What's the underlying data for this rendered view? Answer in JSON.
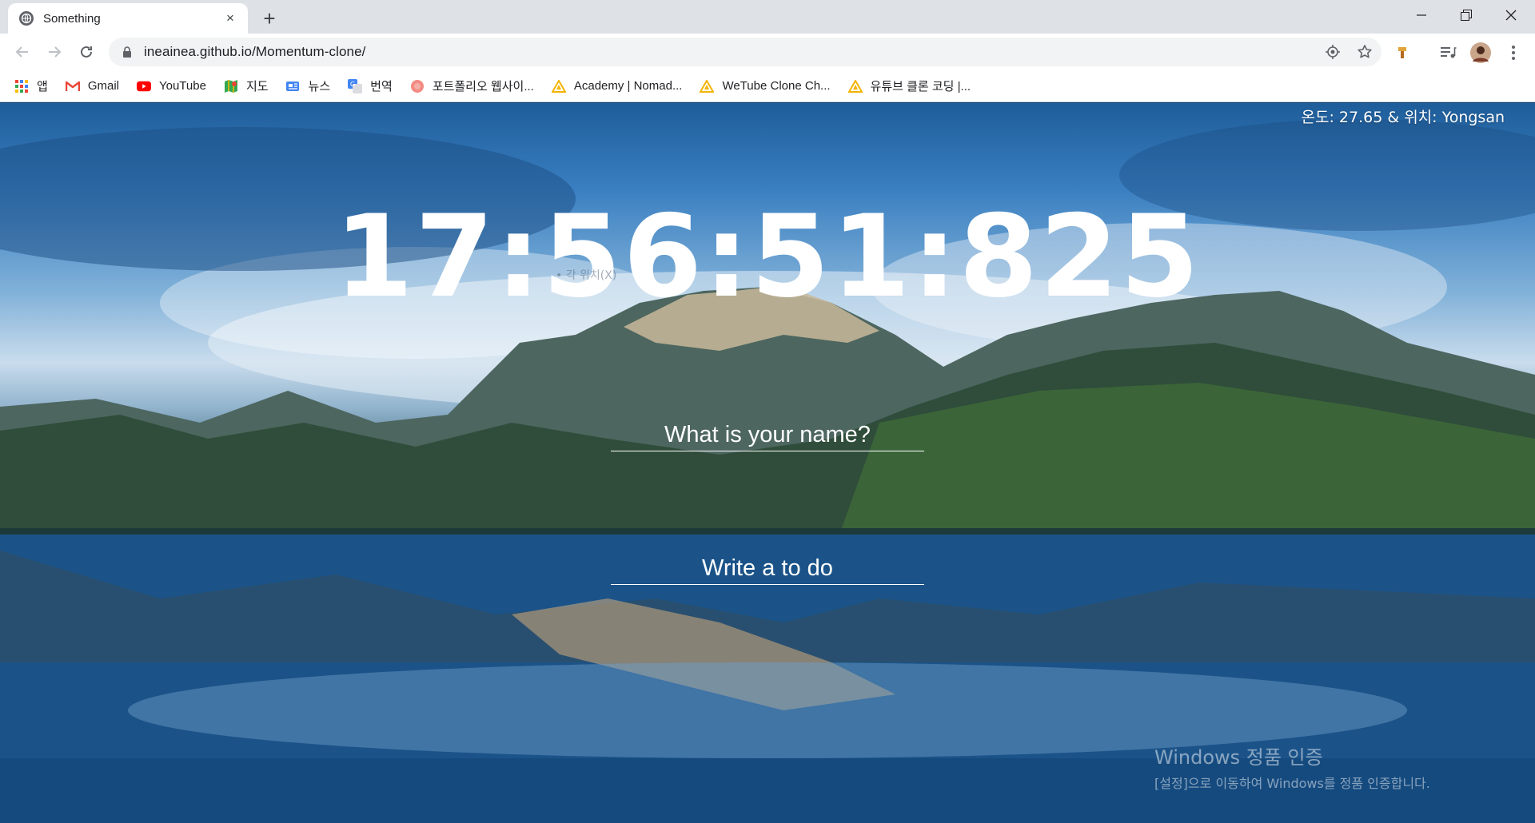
{
  "tab": {
    "title": "Something",
    "close_glyph": "×",
    "new_tab_glyph": "+",
    "favicon": "globe-icon"
  },
  "window_controls": {
    "minimize": "─",
    "maximize": "❐",
    "close": "✕"
  },
  "toolbar": {
    "url": "ineainea.github.io/Momentum-clone/",
    "icons": [
      "back-icon",
      "forward-icon",
      "reload-icon",
      "lock-icon",
      "location-icon",
      "star-icon",
      "extension-icon",
      "media-icon",
      "avatar",
      "menu-icon"
    ]
  },
  "bookmarks": [
    {
      "label": "앱",
      "icon": "apps-grid-icon"
    },
    {
      "label": "Gmail",
      "icon": "gmail-icon"
    },
    {
      "label": "YouTube",
      "icon": "youtube-icon"
    },
    {
      "label": "지도",
      "icon": "maps-icon"
    },
    {
      "label": "뉴스",
      "icon": "news-icon"
    },
    {
      "label": "번역",
      "icon": "translate-icon"
    },
    {
      "label": "포트폴리오 웹사이...",
      "icon": "portfolio-icon"
    },
    {
      "label": "Academy | Nomad...",
      "icon": "nomad-icon"
    },
    {
      "label": "WeTube Clone Ch...",
      "icon": "nomad-icon"
    },
    {
      "label": "유튜브 클론 코딩 |...",
      "icon": "nomad-icon"
    }
  ],
  "page": {
    "weather": "온도: 27.65 & 위치: Yongsan",
    "clock": "17:56:51:825",
    "name_placeholder": "What is your name?",
    "todo_placeholder": "Write a to do",
    "faint_bullet": "• 각 위치(X)",
    "watermark_line1": "Windows 정품 인증",
    "watermark_line2": "[설정]으로 이동하여 Windows를 정품 인증합니다."
  },
  "colors": {
    "chrome_tabstrip": "#dee1e6",
    "text_white": "#ffffff",
    "sky": "#3a7fc1",
    "lake": "#1c5a8e"
  }
}
